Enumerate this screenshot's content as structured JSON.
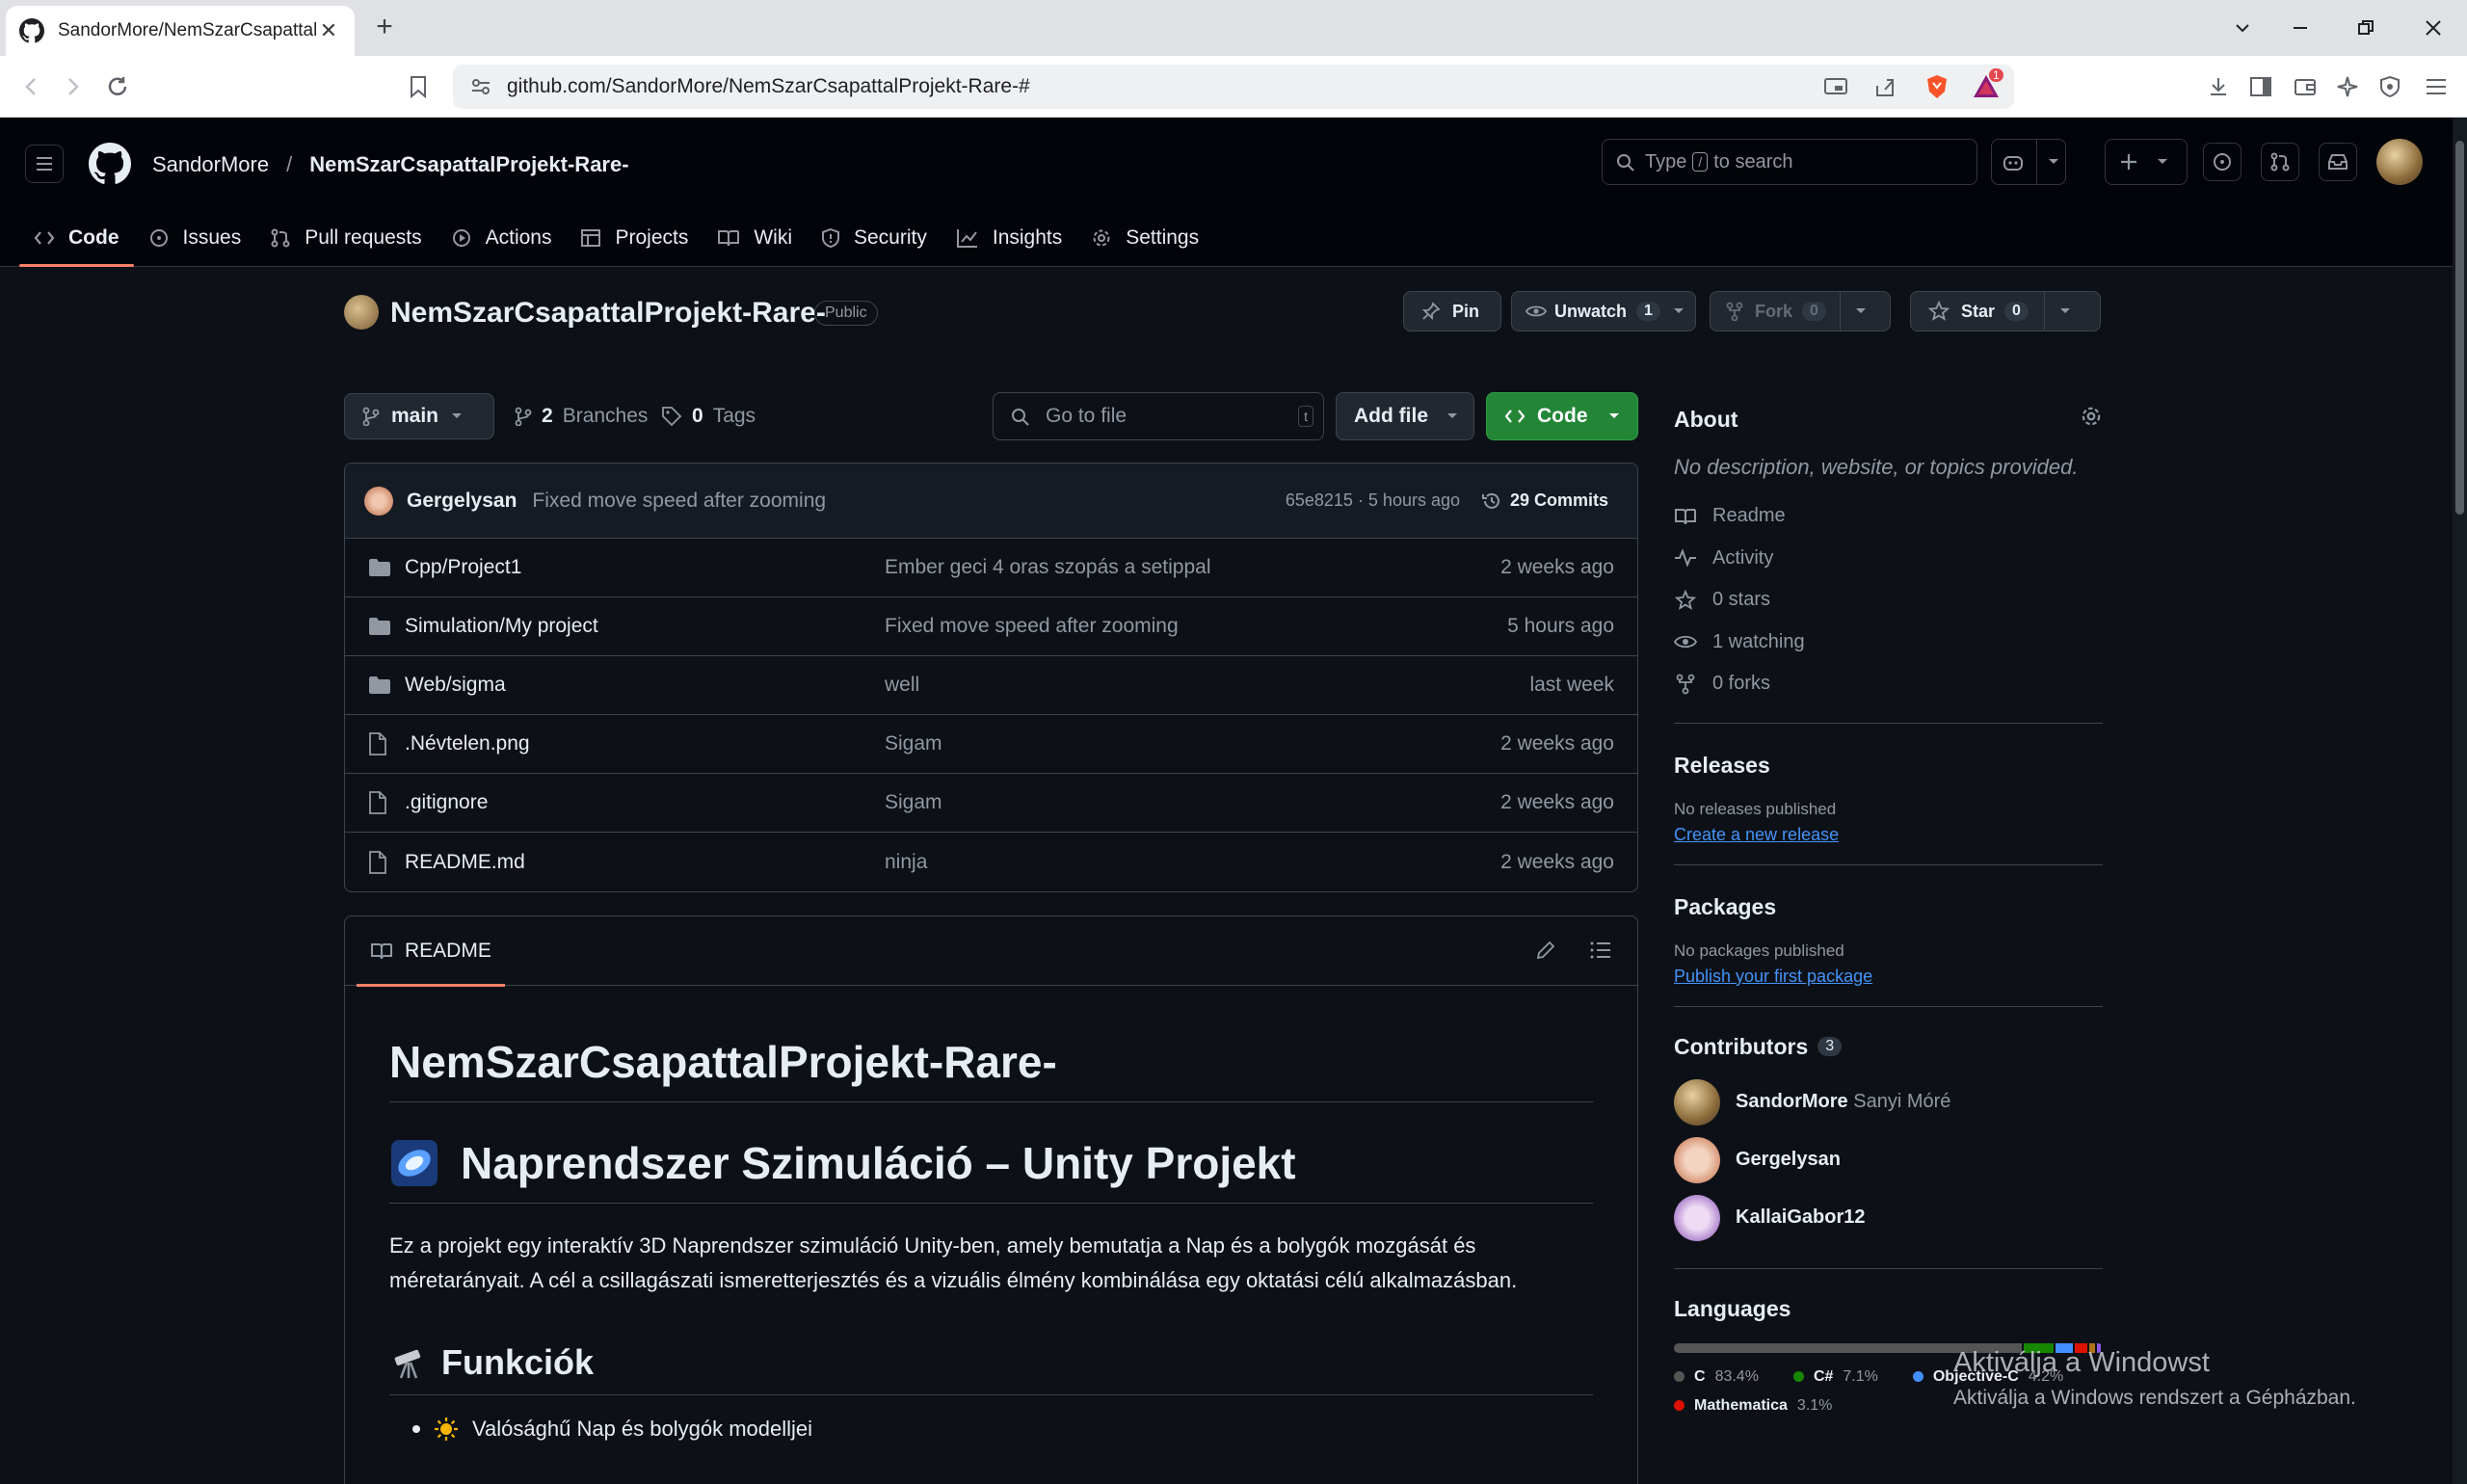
{
  "browser": {
    "tab_title": "SandorMore/NemSzarCsapattalP",
    "url": "github.com/SandorMore/NemSzarCsapattalProjekt-Rare-#",
    "extension_badge": "1"
  },
  "header": {
    "owner": "SandorMore",
    "separator": "/",
    "repo": "NemSzarCsapattalProjekt-Rare-",
    "search_prefix": "Type",
    "search_key": "/",
    "search_suffix": "to search"
  },
  "repo_nav": [
    {
      "label": "Code",
      "icon": "code-icon",
      "active": true
    },
    {
      "label": "Issues",
      "icon": "issue-opened-icon"
    },
    {
      "label": "Pull requests",
      "icon": "git-pull-request-icon"
    },
    {
      "label": "Actions",
      "icon": "play-icon"
    },
    {
      "label": "Projects",
      "icon": "table-icon"
    },
    {
      "label": "Wiki",
      "icon": "book-icon"
    },
    {
      "label": "Security",
      "icon": "shield-icon"
    },
    {
      "label": "Insights",
      "icon": "graph-icon"
    },
    {
      "label": "Settings",
      "icon": "gear-icon"
    }
  ],
  "repo": {
    "name": "NemSzarCsapattalProjekt-Rare-",
    "visibility": "Public",
    "pin": "Pin",
    "unwatch": "Unwatch",
    "watch_count": "1",
    "fork": "Fork",
    "fork_count": "0",
    "star": "Star",
    "star_count": "0"
  },
  "branch_bar": {
    "branch": "main",
    "branches_count": "2",
    "branches_label": "Branches",
    "tags_count": "0",
    "tags_label": "Tags",
    "goto_placeholder": "Go to file",
    "goto_key": "t",
    "add_file": "Add file",
    "code": "Code"
  },
  "latest_commit": {
    "author": "Gergelysan",
    "message": "Fixed move speed after zooming",
    "hash_time": "65e8215 · 5 hours ago",
    "commits": "29 Commits"
  },
  "files": [
    {
      "type": "dir",
      "name": "Cpp/Project1",
      "message": "Ember geci 4 oras szopás a setippal",
      "when": "2 weeks ago"
    },
    {
      "type": "dir",
      "name": "Simulation/My project",
      "message": "Fixed move speed after zooming",
      "when": "5 hours ago"
    },
    {
      "type": "dir",
      "name": "Web/sigma",
      "message": "well",
      "when": "last week"
    },
    {
      "type": "file",
      "name": ".Névtelen.png",
      "message": "Sigam",
      "when": "2 weeks ago"
    },
    {
      "type": "file",
      "name": ".gitignore",
      "message": "Sigam",
      "when": "2 weeks ago"
    },
    {
      "type": "file",
      "name": "README.md",
      "message": "ninja",
      "when": "2 weeks ago"
    }
  ],
  "readme": {
    "tab": "README",
    "h1": "NemSzarCsapattalProjekt-Rare-",
    "h1b": "Naprendszer Szimuláció – Unity Projekt",
    "p": "Ez a projekt egy interaktív 3D Naprendszer szimuláció Unity-ben, amely bemutatja a Nap és a bolygók mozgását és méretarányait. A cél a csillagászati ismeretterjesztés és a vizuális élmény kombinálása egy oktatási célú alkalmazásban.",
    "h2": "Funkciók",
    "li1": "Valósághű Nap és bolygók modelljei"
  },
  "about": {
    "title": "About",
    "description": "No description, website, or topics provided.",
    "items": [
      {
        "icon": "book-icon",
        "label": "Readme"
      },
      {
        "icon": "pulse-icon",
        "label": "Activity"
      },
      {
        "icon": "star-icon",
        "label": "0 stars"
      },
      {
        "icon": "eye-icon",
        "label": "1 watching"
      },
      {
        "icon": "repo-forked-icon",
        "label": "0 forks"
      }
    ]
  },
  "releases": {
    "title": "Releases",
    "none": "No releases published",
    "link": "Create a new release"
  },
  "packages": {
    "title": "Packages",
    "none": "No packages published",
    "link": "Publish your first package"
  },
  "contributors": {
    "title": "Contributors",
    "count": "3",
    "list": [
      {
        "login": "SandorMore",
        "name": "Sanyi Móré"
      },
      {
        "login": "Gergelysan",
        "name": ""
      },
      {
        "login": "KallaiGabor12",
        "name": ""
      }
    ]
  },
  "languages": {
    "title": "Languages",
    "list": [
      {
        "name": "C",
        "pct": "83.4%",
        "value": 83.4,
        "color": "#555555"
      },
      {
        "name": "C#",
        "pct": "7.1%",
        "value": 7.1,
        "color": "#178600"
      },
      {
        "name": "Objective-C",
        "pct": "4.2%",
        "value": 4.2,
        "color": "#438eff"
      },
      {
        "name": "Mathematica",
        "pct": "3.1%",
        "value": 3.1,
        "color": "#dd1100"
      }
    ],
    "other_values": [
      1.2,
      1.0
    ],
    "other_colors": [
      "#b07219",
      "#8957e5"
    ]
  },
  "watermark": {
    "line1": "Aktiválja a Windowst",
    "line2": "Aktiválja a Windows rendszert a Gépházban."
  },
  "colors": {
    "accent_green": "#238636",
    "underline": "#f78166",
    "link": "#4493f8"
  }
}
